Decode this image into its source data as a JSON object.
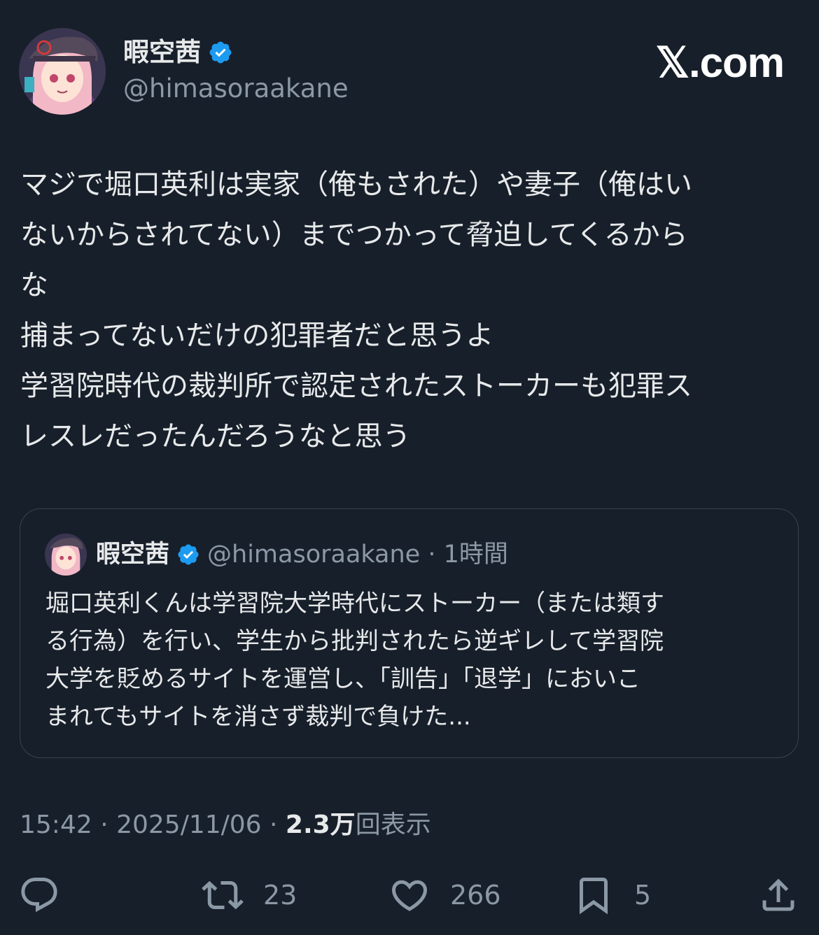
{
  "header": {
    "display_name": "暇空茜",
    "handle": "@himasoraakane",
    "brand": "𝕏.com"
  },
  "post": {
    "lines": [
      "マジで堀口英利は実家（俺もされた）や妻子（俺はい",
      "ないからされてない）までつかって脅迫してくるから",
      "な",
      "捕まってないだけの犯罪者だと思うよ",
      "学習院時代の裁判所で認定されたストーカーも犯罪ス",
      "レスレだったんだろうなと思う"
    ]
  },
  "quote": {
    "display_name": "暇空茜",
    "meta": "@himasoraakane · 1時間",
    "lines": [
      "堀口英利くんは学習院大学時代にストーカー（または類す",
      "る行為）を行い、学生から批判されたら逆ギレして学習院",
      "大学を貶めるサイトを運営し、「訓告」「退学」においこ",
      "まれてもサイトを消さず裁判で負けた..."
    ]
  },
  "meta": {
    "time_date": "15:42 · 2025/11/06 · ",
    "views_count": "2.3万",
    "views_label": "回表示"
  },
  "actions": {
    "reply_icon": "reply-icon",
    "retweet_icon": "retweet-icon",
    "retweet_count": "23",
    "like_icon": "heart-icon",
    "like_count": "266",
    "bookmark_icon": "bookmark-icon",
    "bookmark_count": "5",
    "share_icon": "share-icon"
  },
  "colors": {
    "background": "#171f2a",
    "text": "#e7e9ea",
    "muted": "#8b98a5",
    "verified": "#1d9bf0",
    "border": "#38444d"
  }
}
